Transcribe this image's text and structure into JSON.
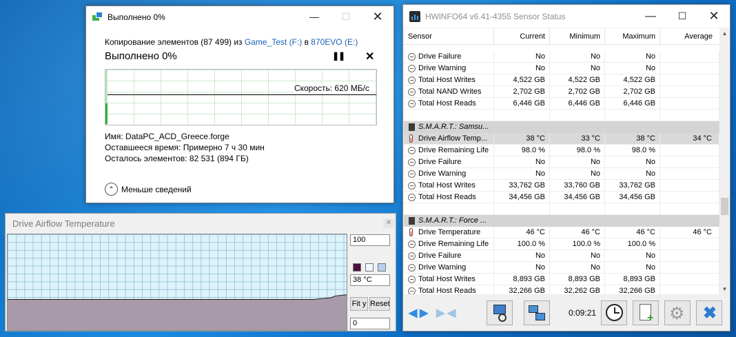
{
  "copy_dialog": {
    "title": "Выполнено 0%",
    "desc_prefix": "Копирование элементов (87 499) из ",
    "source": "Game_Test (F:)",
    "desc_mid": " в ",
    "destination": "870EVO (E:)",
    "percent_label": "Выполнено 0%",
    "speed": "Скорость: 620 МБ/с",
    "progress_fraction": 0.0,
    "name_row": "Имя:  DataPC_ACD_Greece.forge",
    "time_row": "Оставшееся время:  Примерно 7 ч 30 мин",
    "items_row": "Осталось элементов:  82 531 (894 ГБ)",
    "less_details": "Меньше сведений"
  },
  "hwinfo": {
    "title": "HWiNFO64 v6.41-4355 Sensor Status",
    "columns": [
      "Sensor",
      "Current",
      "Minimum",
      "Maximum",
      "Average"
    ],
    "rows": [
      {
        "type": "bool",
        "label": "Drive Failure",
        "cur": "No",
        "min": "No",
        "max": "No",
        "avg": ""
      },
      {
        "type": "bool",
        "label": "Drive Warning",
        "cur": "No",
        "min": "No",
        "max": "No",
        "avg": ""
      },
      {
        "type": "bool",
        "label": "Total Host Writes",
        "cur": "4,522 GB",
        "min": "4,522 GB",
        "max": "4,522 GB",
        "avg": ""
      },
      {
        "type": "bool",
        "label": "Total NAND Writes",
        "cur": "2,702 GB",
        "min": "2,702 GB",
        "max": "2,702 GB",
        "avg": ""
      },
      {
        "type": "bool",
        "label": "Total Host Reads",
        "cur": "6,446 GB",
        "min": "6,446 GB",
        "max": "6,446 GB",
        "avg": ""
      },
      {
        "type": "blank"
      },
      {
        "type": "group",
        "label": "S.M.A.R.T.: Samsu..."
      },
      {
        "type": "temp",
        "label": "Drive Airflow Temp...",
        "cur": "38 °C",
        "min": "33 °C",
        "max": "38 °C",
        "avg": "34 °C",
        "selected": true
      },
      {
        "type": "bool",
        "label": "Drive Remaining Life",
        "cur": "98.0 %",
        "min": "98.0 %",
        "max": "98.0 %",
        "avg": ""
      },
      {
        "type": "bool",
        "label": "Drive Failure",
        "cur": "No",
        "min": "No",
        "max": "No",
        "avg": ""
      },
      {
        "type": "bool",
        "label": "Drive Warning",
        "cur": "No",
        "min": "No",
        "max": "No",
        "avg": ""
      },
      {
        "type": "bool",
        "label": "Total Host Writes",
        "cur": "33,762 GB",
        "min": "33,760 GB",
        "max": "33,762 GB",
        "avg": ""
      },
      {
        "type": "bool",
        "label": "Total Host Reads",
        "cur": "34,456 GB",
        "min": "34,456 GB",
        "max": "34,456 GB",
        "avg": ""
      },
      {
        "type": "blank"
      },
      {
        "type": "group",
        "label": "S.M.A.R.T.: Force ..."
      },
      {
        "type": "temp",
        "label": "Drive Temperature",
        "cur": "46 °C",
        "min": "46 °C",
        "max": "46 °C",
        "avg": "46 °C"
      },
      {
        "type": "bool",
        "label": "Drive Remaining Life",
        "cur": "100.0 %",
        "min": "100.0 %",
        "max": "100.0 %",
        "avg": ""
      },
      {
        "type": "bool",
        "label": "Drive Failure",
        "cur": "No",
        "min": "No",
        "max": "No",
        "avg": ""
      },
      {
        "type": "bool",
        "label": "Drive Warning",
        "cur": "No",
        "min": "No",
        "max": "No",
        "avg": ""
      },
      {
        "type": "bool",
        "label": "Total Host Writes",
        "cur": "8,893 GB",
        "min": "8,893 GB",
        "max": "8,893 GB",
        "avg": ""
      },
      {
        "type": "bool",
        "label": "Total Host Reads",
        "cur": "32,266 GB",
        "min": "32,262 GB",
        "max": "32,266 GB",
        "avg": ""
      }
    ],
    "timer": "0:09:21"
  },
  "airflow_graph": {
    "title": "Drive Airflow Temperature",
    "max_value": "100",
    "current_value": "38 °C",
    "min_value": "0",
    "fit_label": "Fit y",
    "reset_label": "Reset",
    "colors": {
      "fill": "#a89aa8",
      "line": "#222222",
      "grid": "#9bc7da",
      "background": "#ddf3fb"
    }
  }
}
